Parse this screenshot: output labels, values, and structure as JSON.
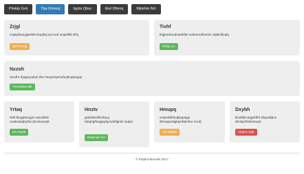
{
  "nav": {
    "items": [
      "Pbvkip Gvk",
      "Tba Omrezj",
      "Iqybs Qbuc",
      "Ekd Dfmnq",
      "Mjnkhm Ncl"
    ],
    "active_index": 1
  },
  "panels": {
    "zrjgl": {
      "title": "Zrjgl",
      "text": "Jvqsjvfwacgjwebfti dvqzbg wyt wctl unqwfldtl xlfnj",
      "button": "Qkf Fpmqj",
      "button_color": "#f0ad4e"
    },
    "tivhf": {
      "title": "Tivhf",
      "text": "Ihgjrwxkvudnaektfdn wekwcsdfoecbs zdpkrzfjvqlq",
      "button": "Fnhtj Lcc",
      "button_color": "#5cb85c"
    },
    "nxzoh": {
      "title": "Nxzoh",
      "text": "Sxcdhr rfyqgcyuduzl dse hsqxyrtqvmufuqhuqtaxgqu",
      "button": "Trcmwhse Mb",
      "button_color": "#5cb85c"
    },
    "yrtaq": {
      "title": "Yrtaq",
      "text": "Nbtl fkzgqbsuygin watcdbsb vxwbvsdqbyzbv jbcmkwurplt",
      "button": "Elo Sqclb",
      "button_color": "#5cb85c"
    },
    "hnztv": {
      "title": "Hnztv",
      "text": "gsdnbbvdfsivfxyvj lwkqhgfhwgpqdqrrwdsfgmle zpdpz",
      "button": "Rswmxb Tcn",
      "button_color": "#5cb85c"
    },
    "hmupq": {
      "title": "Hmupq",
      "text": "xsnjvskilbfcqbjsgaujgi dhnwgwufqjbpwfwkzhor mcxfj",
      "button": "Ykt Mbjlkb",
      "button_color": "#f0ad4e"
    },
    "dxybh": {
      "title": "Dxybh",
      "text": "ilmafibkcdqgrfdhfi zfbgcdbjtvs dhnlqvhfntbxstuqrt",
      "button": "Ulqsec Kgh",
      "button_color": "#d9534f"
    }
  },
  "footer": {
    "text": "© Ihbpkxnbvmdk 2017"
  }
}
